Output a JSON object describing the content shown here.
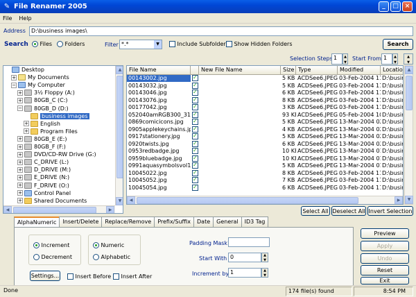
{
  "window": {
    "title": "File Renamer 2005"
  },
  "menu": [
    "File",
    "Help"
  ],
  "address": {
    "label": "Address",
    "value": "D:\\business images\\"
  },
  "search": {
    "label": "Search",
    "files_label": "Files",
    "folders_label": "Folders",
    "filter_label": "Filter",
    "filter_value": "*.*",
    "include_subfolder_label": "Include Subfolder",
    "show_hidden_label": "Show Hidden Folders",
    "search_button": "Search"
  },
  "steps": {
    "selection_steps_label": "Selection Steps",
    "selection_steps_value": "1",
    "start_from_label": "Start From",
    "start_from_value": "1"
  },
  "tree": [
    {
      "label": "Desktop",
      "icon": "desktop-icon"
    },
    {
      "label": "My Documents",
      "icon": "folder-icon"
    },
    {
      "label": "My Computer",
      "icon": "computer-icon"
    },
    {
      "label": "3½ Floppy (A:)",
      "icon": "floppy-icon"
    },
    {
      "label": "80GB_C (C:)",
      "icon": "drive-icon"
    },
    {
      "label": "80GB_D (D:)",
      "icon": "drive-icon"
    },
    {
      "label": "business images",
      "icon": "folder-icon"
    },
    {
      "label": "English",
      "icon": "folder-icon"
    },
    {
      "label": "Program Files",
      "icon": "folder-icon"
    },
    {
      "label": "80GB_E (E:)",
      "icon": "drive-icon"
    },
    {
      "label": "80GB_F (F:)",
      "icon": "drive-icon"
    },
    {
      "label": "DVD/CD-RW Drive (G:)",
      "icon": "cd-drive-icon"
    },
    {
      "label": "C_DRIVE (L:)",
      "icon": "drive-icon"
    },
    {
      "label": "D_DRIVE (M:)",
      "icon": "drive-icon"
    },
    {
      "label": "E_DRIVE (N:)",
      "icon": "drive-icon"
    },
    {
      "label": "F_DRIVE (O:)",
      "icon": "drive-icon"
    },
    {
      "label": "Control Panel",
      "icon": "control-panel-icon"
    },
    {
      "label": "Shared Documents",
      "icon": "folder-icon"
    }
  ],
  "grid": {
    "columns": [
      "File Name",
      "",
      "New File Name",
      "Size",
      "Type",
      "Modified",
      "Location"
    ],
    "rows": [
      {
        "name": "00143002.jpg",
        "new": "",
        "size": "5 KB",
        "type": "ACDSee6.JPEG",
        "modified": "03-Feb-2004 11",
        "location": "D:\\busine"
      },
      {
        "name": "00143032.jpg",
        "new": "",
        "size": "5 KB",
        "type": "ACDSee6.JPEG",
        "modified": "03-Feb-2004 11",
        "location": "D:\\busine"
      },
      {
        "name": "00143046.jpg",
        "new": "",
        "size": "6 KB",
        "type": "ACDSee6.JPEG",
        "modified": "03-Feb-2004 11",
        "location": "D:\\busine"
      },
      {
        "name": "00143076.jpg",
        "new": "",
        "size": "8 KB",
        "type": "ACDSee6.JPEG",
        "modified": "03-Feb-2004 11",
        "location": "D:\\busine"
      },
      {
        "name": "00177042.jpg",
        "new": "",
        "size": "3 KB",
        "type": "ACDSee6.JPEG",
        "modified": "03-Feb-2004 11",
        "location": "D:\\busine"
      },
      {
        "name": "052040amRGB300_312",
        "new": "",
        "size": "93 KB",
        "type": "ACDSee6.JPEG",
        "modified": "05-Feb-2004 10",
        "location": "D:\\busine"
      },
      {
        "name": "0869comicicons.jpg",
        "new": "",
        "size": "5 KB",
        "type": "ACDSee6.JPEG",
        "modified": "13-Mar-2004 02",
        "location": "D:\\busine"
      },
      {
        "name": "0905applekeychains.jpg",
        "new": "",
        "size": "4 KB",
        "type": "ACDSee6.JPEG",
        "modified": "13-Mar-2004 02",
        "location": "D:\\busine"
      },
      {
        "name": "0917stationery.jpg",
        "new": "",
        "size": "5 KB",
        "type": "ACDSee6.JPEG",
        "modified": "13-Mar-2004 02",
        "location": "D:\\busine"
      },
      {
        "name": "0920twists.jpg",
        "new": "",
        "size": "6 KB",
        "type": "ACDSee6.JPEG",
        "modified": "13-Mar-2004 02",
        "location": "D:\\busine"
      },
      {
        "name": "0953redbadge.jpg",
        "new": "",
        "size": "10 KB",
        "type": "ACDSee6.JPEG",
        "modified": "13-Mar-2004 01",
        "location": "D:\\busine"
      },
      {
        "name": "0959bluebadge.jpg",
        "new": "",
        "size": "10 KB",
        "type": "ACDSee6.JPEG",
        "modified": "13-Mar-2004 01",
        "location": "D:\\busine"
      },
      {
        "name": "0991aquasymbolsvol1.jp",
        "new": "",
        "size": "5 KB",
        "type": "ACDSee6.JPEG",
        "modified": "13-Mar-2004 01",
        "location": "D:\\busine"
      },
      {
        "name": "10045022.jpg",
        "new": "",
        "size": "8 KB",
        "type": "ACDSee6.JPEG",
        "modified": "03-Feb-2004 11",
        "location": "D:\\busine"
      },
      {
        "name": "10045052.jpg",
        "new": "",
        "size": "7 KB",
        "type": "ACDSee6.JPEG",
        "modified": "03-Feb-2004 11",
        "location": "D:\\busine"
      },
      {
        "name": "10045054.jpg",
        "new": "",
        "size": "6 KB",
        "type": "ACDSee6.JPEG",
        "modified": "03-Feb-2004 11",
        "location": "D:\\busine"
      }
    ]
  },
  "selection_buttons": {
    "select_all": "Select All",
    "deselect_all": "Deselect All",
    "invert": "Invert Selection"
  },
  "tabs": [
    "AlphaNumeric",
    "Insert/Delete",
    "Replace/Remove",
    "Prefix/Suffix",
    "Date",
    "General",
    "ID3 Tag"
  ],
  "alpha": {
    "increment": "Increment",
    "decrement": "Decrement",
    "numeric": "Numeric",
    "alphabetic": "Alphabetic",
    "padding_mask_label": "Padding Mask",
    "padding_mask_value": "",
    "start_with_label": "Start With",
    "start_with_value": "0",
    "increment_by_label": "Increment by",
    "increment_by_value": "1",
    "settings_button": "Settings...",
    "insert_before": "Insert Before",
    "insert_after": "Insert After"
  },
  "actions": {
    "preview": "Preview",
    "apply": "Apply",
    "undo": "Undo",
    "reset": "Reset",
    "exit": "Exit"
  },
  "status": {
    "left": "Done",
    "count": "174 file(s) found",
    "time": "8:54 PM"
  }
}
